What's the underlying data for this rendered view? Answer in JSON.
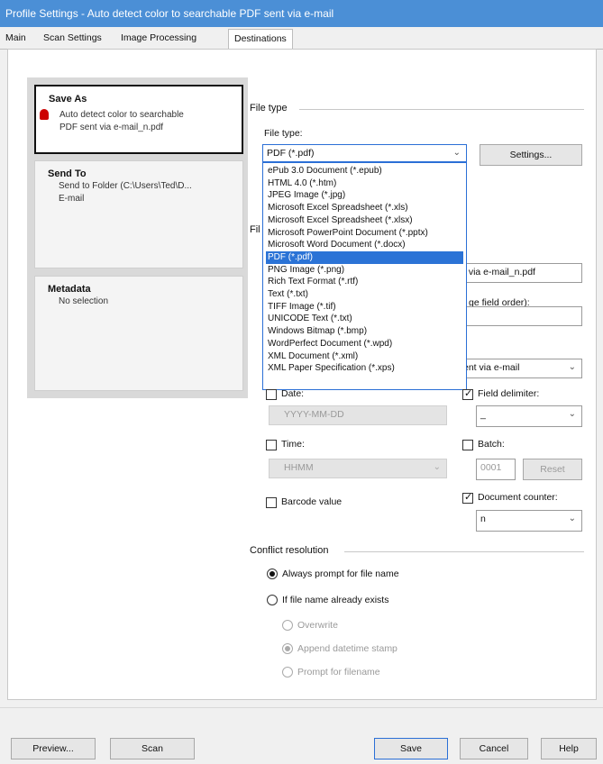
{
  "window": {
    "title": "Profile Settings - Auto detect color to searchable PDF sent via e-mail"
  },
  "tabs": [
    {
      "label": "Main"
    },
    {
      "label": "Scan Settings"
    },
    {
      "label": "Image Processing"
    },
    {
      "label": "Destinations"
    }
  ],
  "left_cards": {
    "save_as": {
      "title": "Save As",
      "line1": "Auto detect color to searchable",
      "line2": "PDF sent via e-mail_n.pdf"
    },
    "send_to": {
      "title": "Send To",
      "line1": "Send to Folder (C:\\Users\\Ted\\D...",
      "line2": "E-mail"
    },
    "metadata": {
      "title": "Metadata",
      "line1": "No selection"
    }
  },
  "file_type": {
    "section_label": "File type",
    "field_label": "File type:",
    "selected": "PDF (*.pdf)",
    "settings_button": "Settings...",
    "options": [
      "ePub 3.0 Document (*.epub)",
      "HTML 4.0 (*.htm)",
      "JPEG Image (*.jpg)",
      "Microsoft Excel Spreadsheet (*.xls)",
      "Microsoft Excel Spreadsheet (*.xlsx)",
      "Microsoft PowerPoint Document (*.pptx)",
      "Microsoft Word Document (*.docx)",
      "PDF (*.pdf)",
      "PNG Image (*.png)",
      "Rich Text Format (*.rtf)",
      "Text (*.txt)",
      "TIFF Image (*.tif)",
      "UNICODE Text (*.txt)",
      "Windows Bitmap (*.bmp)",
      "WordPerfect Document (*.wpd)",
      "XML Document (*.xml)",
      "XML Paper Specification (*.xps)"
    ]
  },
  "file_name": {
    "section_label_partial": "Fil",
    "name_value_partial": "t via e-mail_n.pdf",
    "order_label_partial": "ge field order):",
    "prefix_value_partial": "ent via e-mail",
    "date_label": "Date:",
    "date_format": "YYYY-MM-DD",
    "field_delimiter_label": "Field delimiter:",
    "field_delimiter_value": "_",
    "time_label": "Time:",
    "time_format": "HHMM",
    "batch_label": "Batch:",
    "batch_value": "0001",
    "reset_button": "Reset",
    "barcode_label": "Barcode value",
    "doc_counter_label": "Document counter:",
    "doc_counter_value": "n"
  },
  "conflict": {
    "section_label": "Conflict resolution",
    "always_prompt": "Always prompt for file name",
    "if_exists": "If file name already exists",
    "overwrite": "Overwrite",
    "append": "Append datetime stamp",
    "prompt": "Prompt for filename"
  },
  "bottom_buttons": {
    "preview": "Preview...",
    "scan": "Scan",
    "save": "Save",
    "cancel": "Cancel",
    "help": "Help"
  }
}
